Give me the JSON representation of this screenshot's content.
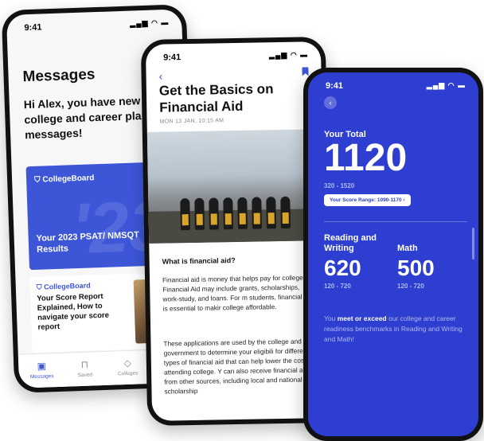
{
  "phone1": {
    "time": "9:41",
    "title": "Messages",
    "greeting": "Hi Alex, you have new college and career planning messages!",
    "card1": {
      "brand": "CollegeBoard",
      "bg_number": "'23",
      "text": "Your 2023 PSAT/ NMSQT Results"
    },
    "card2": {
      "brand": "CollegeBoard",
      "text": "Your Score Report Explained, How to navigate your score report"
    },
    "tabs": [
      {
        "label": "Messages"
      },
      {
        "label": "Saved"
      },
      {
        "label": "Colleges"
      }
    ],
    "accent": "#3d56d8"
  },
  "phone2": {
    "time": "9:41",
    "back": "‹",
    "title": "Get the Basics on Financial Aid",
    "date": "MON 13 JAN, 10:15 AM",
    "heading": "What is financial aid?",
    "para1": "Financial aid is money that helps pay for college. Financial Aid may include grants, scholarships, work-study, and loans. For m students, financial aid is essential to makir college affordable.",
    "para2": "These applications are used by the college and government to determine your eligibili for different types of financial aid that can help lower the cost of attending college. Y can also receive financial aid from other sources, including local and national scholarship"
  },
  "phone3": {
    "time": "9:41",
    "back": "‹",
    "total_label": "Your Total",
    "total": "1120",
    "total_range": "320 - 1520",
    "pill": "Your Score Range: 1090-1170 ›",
    "rw_label": "Reading and Writing",
    "rw_score": "620",
    "rw_range": "120 - 720",
    "math_label": "Math",
    "math_score": "500",
    "math_range": "120 - 720",
    "note_pre": "You ",
    "note_bold": "meet or exceed",
    "note_post": " our college and career readiness benchmarks in Reading and Writing and Math!",
    "bg": "#2d3ed0"
  }
}
